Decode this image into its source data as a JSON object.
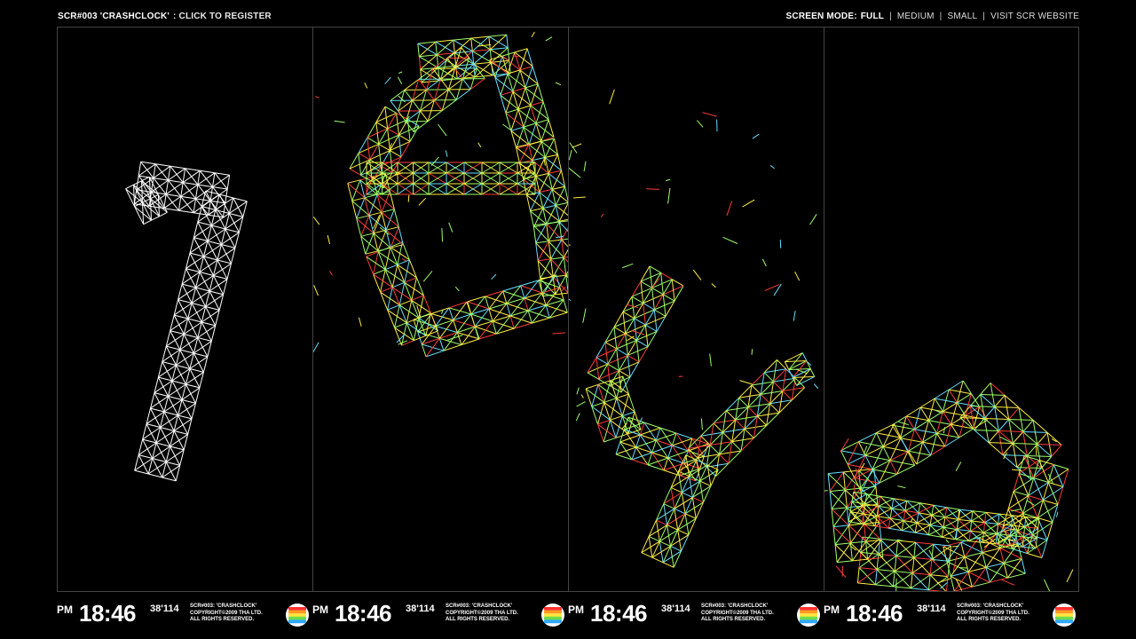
{
  "topbar": {
    "title": "SCR#003 'CRASHCLOCK'",
    "register": ": CLICK TO REGISTER",
    "mode_label": "SCREEN MODE:",
    "modes": [
      "FULL",
      "MEDIUM",
      "SMALL"
    ],
    "visit": "VISIT SCR WEBSITE"
  },
  "digits": [
    "1",
    "8",
    "4",
    "6"
  ],
  "clocks": [
    {
      "ampm": "PM",
      "time": "18:46",
      "sec": "38'114",
      "line1": "SCR#003: 'CRASHCLOCK'",
      "line2": "COPYRIGHT©2009 THA LTD.",
      "line3": "ALL RIGHTS RESERVED."
    },
    {
      "ampm": "PM",
      "time": "18:46",
      "sec": "38'114",
      "line1": "SCR#003: 'CRASHCLOCK'",
      "line2": "COPYRIGHT©2009 THA LTD.",
      "line3": "ALL RIGHTS RESERVED."
    },
    {
      "ampm": "PM",
      "time": "18:46",
      "sec": "38'114",
      "line1": "SCR#003: 'CRASHCLOCK'",
      "line2": "COPYRIGHT©2009 THA LTD.",
      "line3": "ALL RIGHTS RESERVED."
    },
    {
      "ampm": "PM",
      "time": "18:46",
      "sec": "38'114",
      "line1": "SCR#003: 'CRASHCLOCK'",
      "line2": "COPYRIGHT©2009 THA LTD.",
      "line3": "ALL RIGHTS RESERVED."
    }
  ],
  "colors": {
    "background": "#000000",
    "wire_white": "#ffffff",
    "wire_green": "#9eff6a",
    "wire_yellow": "#ffee44",
    "wire_cyan": "#66e0ff",
    "wire_red": "#ff3b3b"
  }
}
